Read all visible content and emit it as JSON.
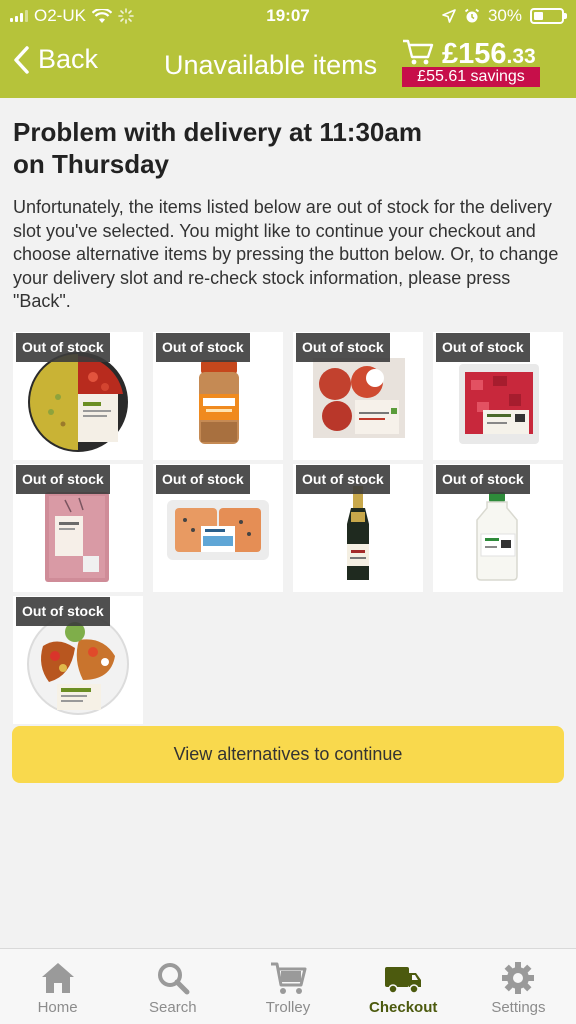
{
  "status_bar": {
    "carrier": "O2-UK",
    "time": "19:07",
    "battery": "30%"
  },
  "header": {
    "back_label": "Back",
    "title": "Unavailable items",
    "price_pounds": "£156",
    "price_pence": ".33",
    "savings": "£55.61 savings"
  },
  "main": {
    "heading_line1": "Problem with delivery at 11:30am",
    "heading_line2": "on Thursday",
    "message": "Unfortunately, the items listed below are out of stock for the delivery slot you've selected. You might like to continue your checkout and choose alternative items by pressing the button below. Or, to change your delivery slot and re-check stock information, please press \"Back\".",
    "out_of_stock_label": "Out of stock",
    "items": [
      {
        "name": "vegan-rice-bowl"
      },
      {
        "name": "coriander-jar"
      },
      {
        "name": "apples-pack"
      },
      {
        "name": "diced-beef"
      },
      {
        "name": "beef-mince"
      },
      {
        "name": "salmon-fillets"
      },
      {
        "name": "sparkling-wine"
      },
      {
        "name": "milk-bottle"
      },
      {
        "name": "vegetarian-salad-bowl"
      }
    ],
    "cta_label": "View alternatives to continue"
  },
  "tabbar": {
    "items": [
      {
        "label": "Home",
        "icon": "home-icon"
      },
      {
        "label": "Search",
        "icon": "search-icon"
      },
      {
        "label": "Trolley",
        "icon": "trolley-icon"
      },
      {
        "label": "Checkout",
        "icon": "delivery-van-icon"
      },
      {
        "label": "Settings",
        "icon": "gear-icon"
      }
    ],
    "active": "Checkout"
  },
  "colors": {
    "header_bg": "#b6c33a",
    "savings_bg": "#c70f4a",
    "cta_bg": "#f9d94d",
    "active_tab": "#4c5a0e"
  }
}
